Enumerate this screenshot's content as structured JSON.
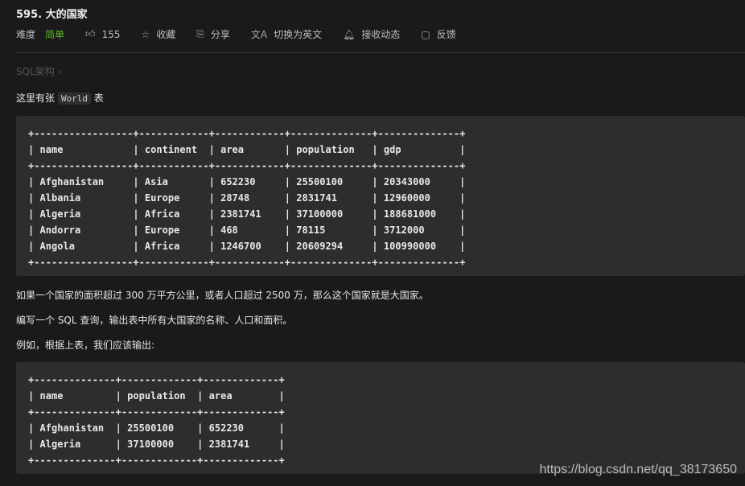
{
  "problem": {
    "title": "595. 大的国家"
  },
  "toolbar": {
    "difficulty_label": "难度",
    "difficulty_value": "简单",
    "difficulty_color": "#5ab726",
    "likes": "155",
    "favorite": "收藏",
    "share": "分享",
    "switch_lang": "切换为英文",
    "subscribe": "接收动态",
    "feedback": "反馈"
  },
  "breadcrumb": "SQL架构 ›",
  "intro": {
    "before": "这里有张",
    "code": "World",
    "after": "表"
  },
  "world_table": {
    "columns": [
      "name",
      "continent",
      "area",
      "population",
      "gdp"
    ],
    "rows": [
      [
        "Afghanistan",
        "Asia",
        "652230",
        "25500100",
        "20343000"
      ],
      [
        "Albania",
        "Europe",
        "28748",
        "2831741",
        "12960000"
      ],
      [
        "Algeria",
        "Africa",
        "2381741",
        "37100000",
        "188681000"
      ],
      [
        "Andorra",
        "Europe",
        "468",
        "78115",
        "3712000"
      ],
      [
        "Angola",
        "Africa",
        "1246700",
        "20609294",
        "100990000"
      ]
    ]
  },
  "paragraphs": [
    "如果一个国家的面积超过 300 万平方公里，或者人口超过 2500 万，那么这个国家就是大国家。",
    "编写一个 SQL 查询，输出表中所有大国家的名称、人口和面积。",
    "例如，根据上表，我们应该输出:"
  ],
  "output_table": {
    "columns": [
      "name",
      "population",
      "area"
    ],
    "rows": [
      [
        "Afghanistan",
        "25500100",
        "652230"
      ],
      [
        "Algeria",
        "37100000",
        "2381741"
      ]
    ]
  },
  "watermark": "https://blog.csdn.net/qq_38173650"
}
